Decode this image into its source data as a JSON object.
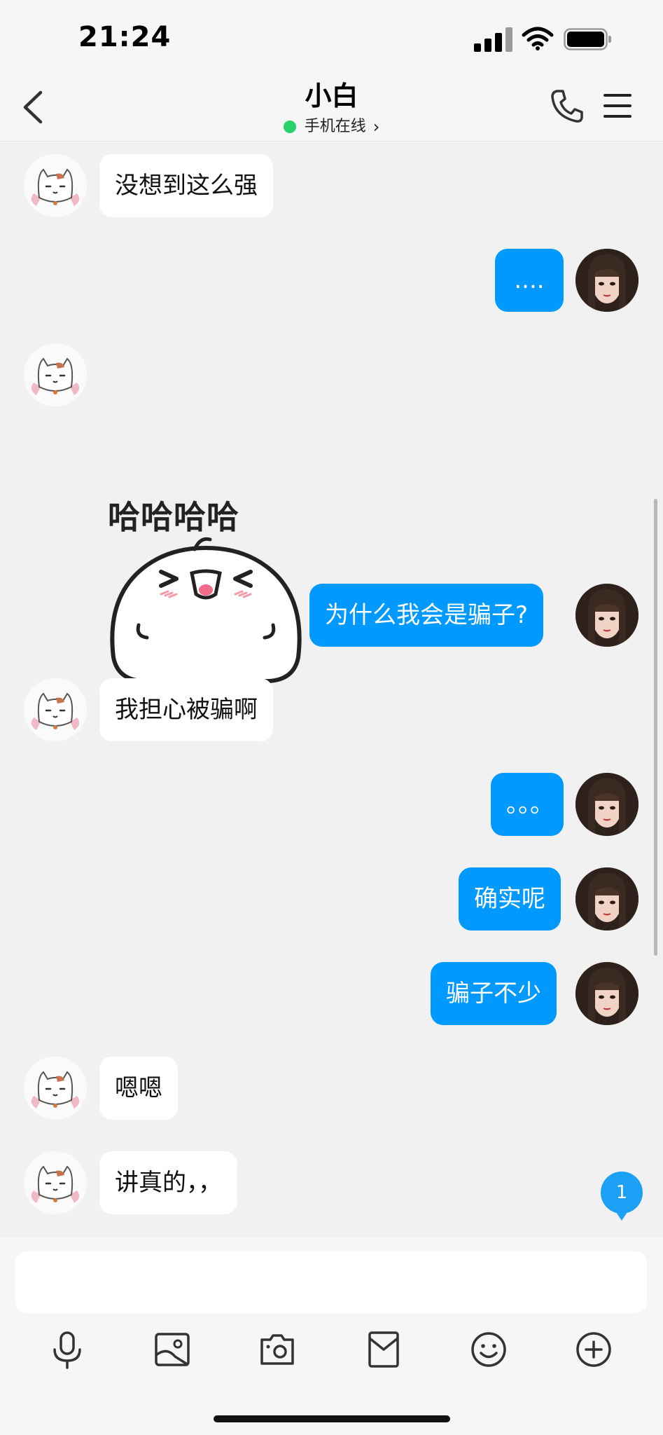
{
  "status_bar": {
    "time": "21:24",
    "signal_icon": "cellular-signal-icon",
    "wifi_icon": "wifi-icon",
    "battery_icon": "battery-icon"
  },
  "header": {
    "title": "小白",
    "status_text": "手机在线",
    "status_color": "#27d36b",
    "back_icon": "chevron-left-icon",
    "call_icon": "phone-icon",
    "menu_icon": "menu-icon"
  },
  "messages": [
    {
      "from": "contact",
      "type": "text",
      "text": "没想到这么强"
    },
    {
      "from": "me",
      "type": "text",
      "text": "...."
    },
    {
      "from": "contact",
      "type": "sticker",
      "text": "哈哈哈哈"
    },
    {
      "from": "me",
      "type": "text",
      "text": "为什么我会是骗子?"
    },
    {
      "from": "contact",
      "type": "text",
      "text": "我担心被骗啊"
    },
    {
      "from": "me",
      "type": "text",
      "text": "。。。"
    },
    {
      "from": "me",
      "type": "text",
      "text": "确实呢"
    },
    {
      "from": "me",
      "type": "text",
      "text": "骗子不少"
    },
    {
      "from": "contact",
      "type": "text",
      "text": "嗯嗯"
    },
    {
      "from": "contact",
      "type": "text",
      "text": "讲真的，，"
    }
  ],
  "unread_badge": "1",
  "colors": {
    "outgoing_bubble": "#0099ff",
    "incoming_bubble": "#ffffff",
    "chat_background": "#f1f1f2"
  },
  "composer": {
    "input_value": "",
    "tools": [
      "microphone-icon",
      "image-icon",
      "camera-icon",
      "red-packet-icon",
      "emoji-icon",
      "plus-icon"
    ]
  }
}
